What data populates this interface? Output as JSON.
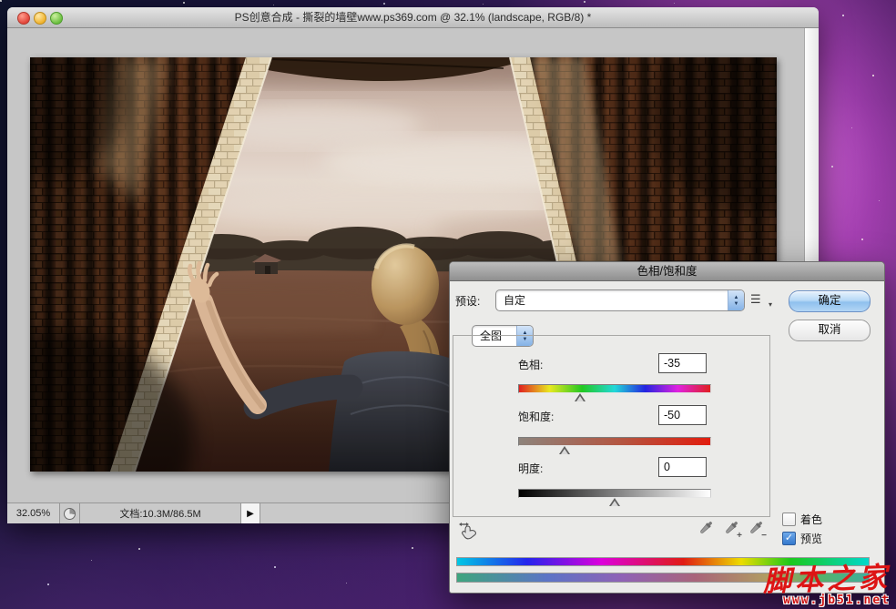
{
  "desktop": {
    "watermark": {
      "name": "脚本之家",
      "url": "www.jb51.net"
    }
  },
  "window": {
    "title": "PS创意合成 - 撕裂的墙壁www.ps369.com @ 32.1% (landscape, RGB/8) *",
    "status": {
      "zoom": "32.05%",
      "doc_info": "文档:10.3M/86.5M"
    }
  },
  "dialog": {
    "title": "色相/饱和度",
    "preset_label": "预设:",
    "preset_value": "自定",
    "ok": "确定",
    "cancel": "取消",
    "channel": "全图",
    "sliders": {
      "hue": {
        "label": "色相:",
        "value": "-35",
        "pointer_style": "left:calc(32% - 6px)"
      },
      "saturation": {
        "label": "饱和度:",
        "value": "-50",
        "pointer_style": "left:calc(24% - 6px)"
      },
      "lightness": {
        "label": "明度:",
        "value": "0",
        "pointer_style": "left:calc(50% - 6px)"
      }
    },
    "colorize_label": "着色",
    "preview_label": "预览"
  },
  "icons": {
    "stepper_up": "▲",
    "stepper_down": "▼",
    "list": "☰",
    "list_caret": "▾",
    "expander": "▶",
    "check": "✓",
    "plus": "+",
    "minus": "−"
  }
}
